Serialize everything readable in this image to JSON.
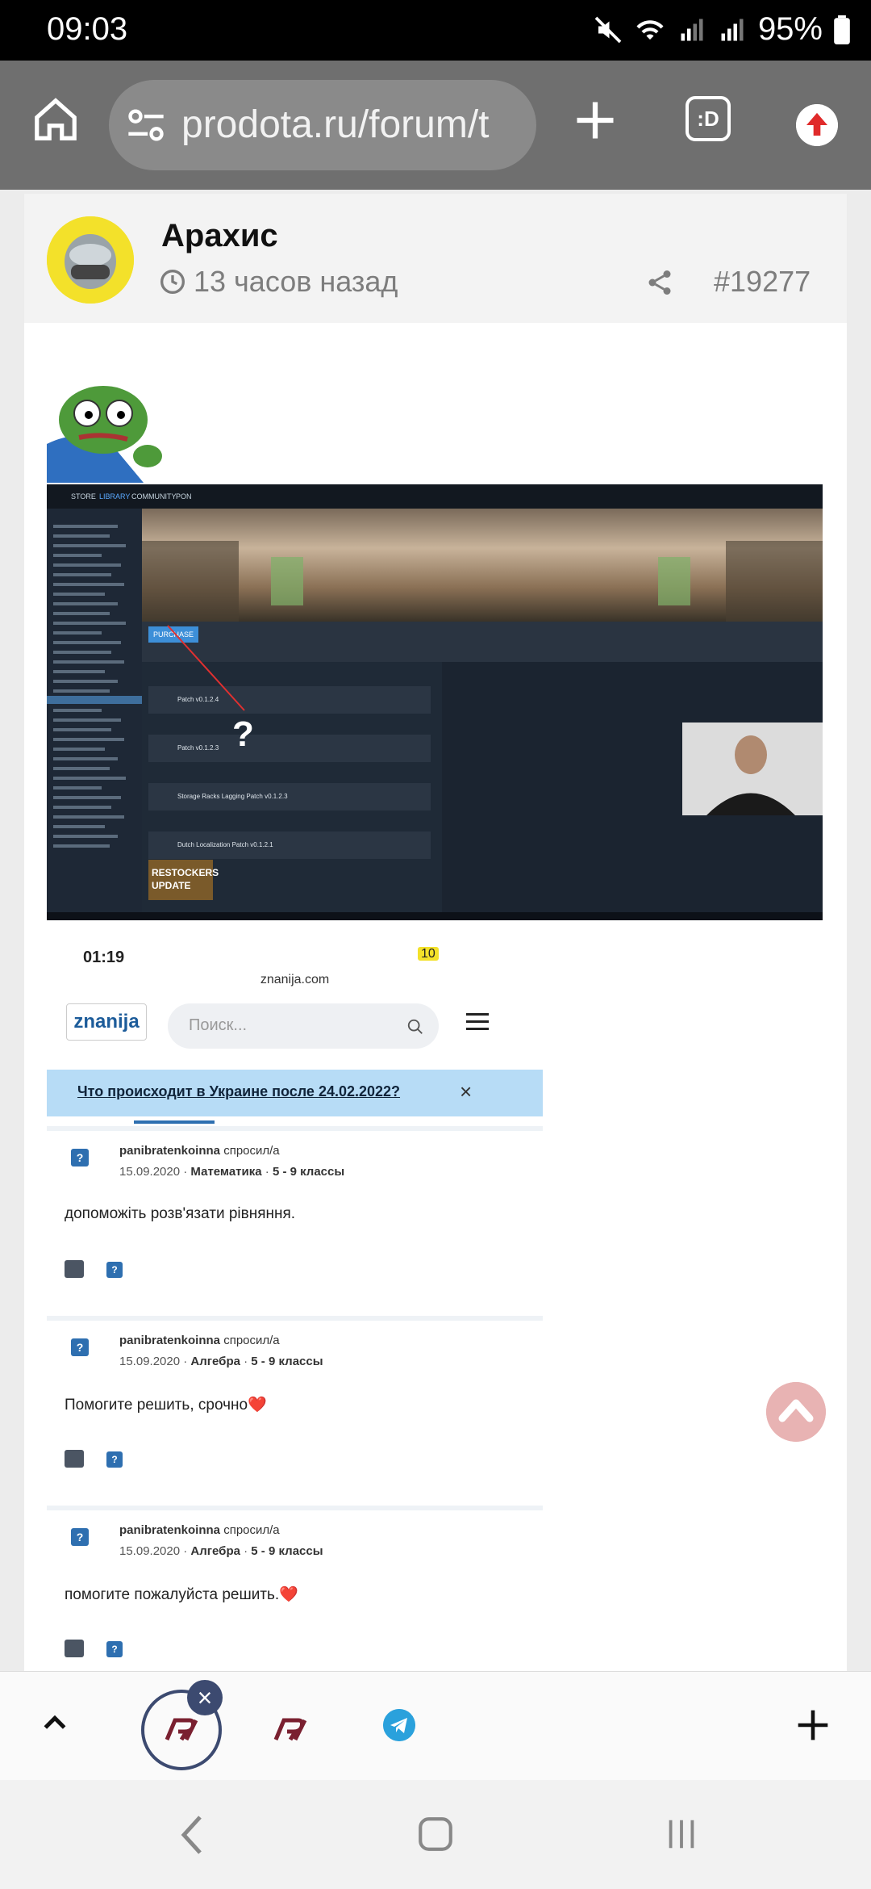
{
  "status_bar": {
    "time": "09:03",
    "battery": "95%"
  },
  "browser": {
    "url": "prodota.ru/forum/t",
    "tab_button_label": ":D"
  },
  "post": {
    "author": "Арахис",
    "time_ago": "13 часов назад",
    "number": "#19277"
  },
  "steam_screenshot": {
    "nav": [
      "STORE",
      "LIBRARY",
      "COMMUNITY",
      "PON"
    ],
    "purchase": "PURCHASE",
    "question": "?",
    "patches": [
      "Patch v0.1.2.4",
      "Patch v0.1.2.3",
      "Storage Racks Lagging Patch v0.1.2.3",
      "Dutch Localization Patch v0.1.2.1"
    ],
    "restockers": "RESTOCKERS UPDATE"
  },
  "znanija_screenshot": {
    "time": "01:19",
    "battery": "10",
    "url": "znanija.com",
    "logo": "znanija",
    "search_placeholder": "Поиск...",
    "banner": "Что происходит в Украине после 24.02.2022?",
    "questions": [
      {
        "user": "panibratenkoinna",
        "verb": "спросил/а",
        "date": "15.09.2020",
        "subject": "Математика",
        "grade": "5 - 9 классы",
        "text": "допоможіть розв'язати рівняння."
      },
      {
        "user": "panibratenkoinna",
        "verb": "спросил/а",
        "date": "15.09.2020",
        "subject": "Алгебра",
        "grade": "5 - 9 классы",
        "text": "Помогите решить, срочно❤️"
      },
      {
        "user": "panibratenkoinna",
        "verb": "спросил/а",
        "date": "15.09.2020",
        "subject": "Алгебра",
        "grade": "5 - 9 классы",
        "text": "помогите пожалуйста решить.❤️"
      }
    ]
  },
  "tabs": {
    "close_symbol": "×"
  }
}
